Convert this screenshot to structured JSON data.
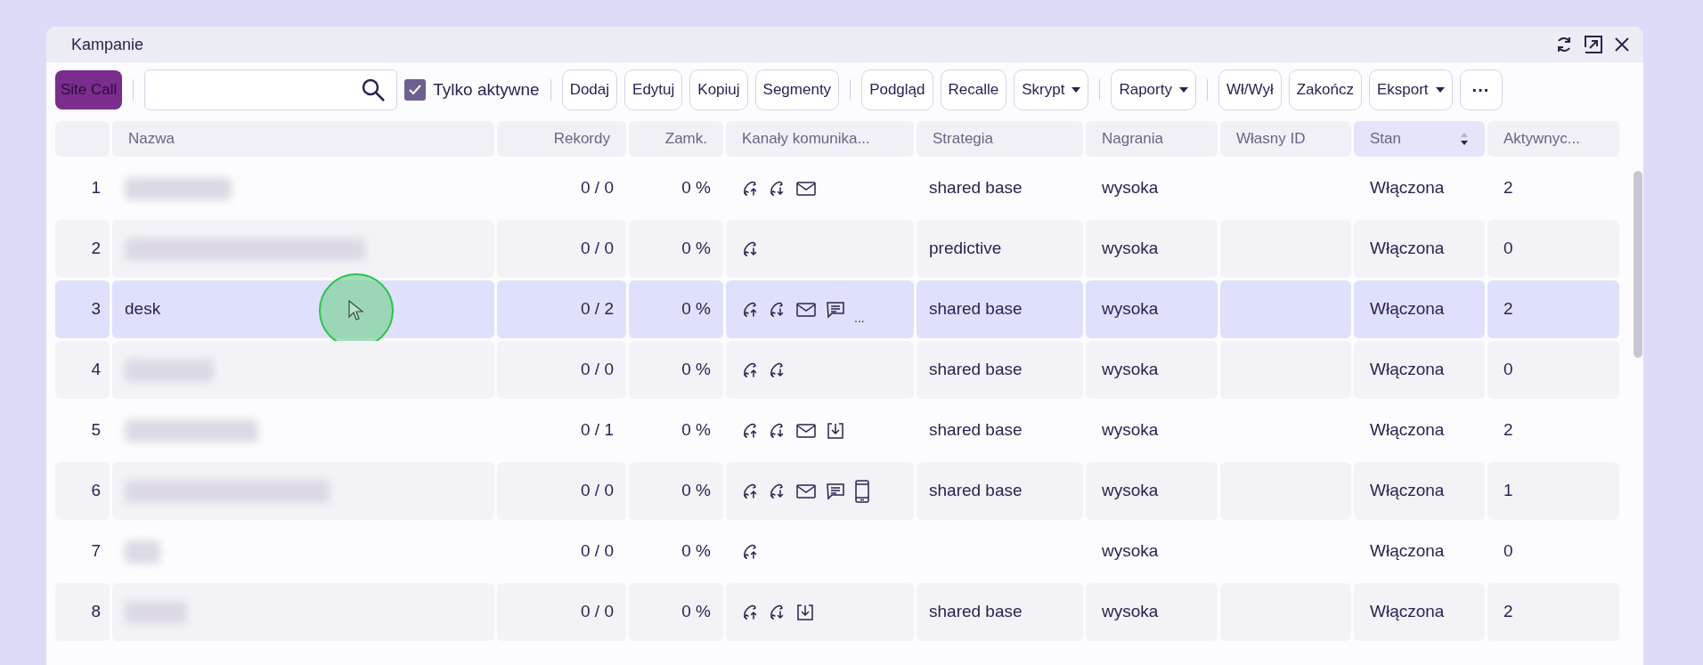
{
  "window": {
    "title": "Kampanie"
  },
  "toolbar": {
    "site_call": "Site Call",
    "only_active": {
      "label": "Tylko aktywne",
      "checked": true
    },
    "groups": [
      [
        {
          "label": "Dodaj",
          "dropdown": false
        },
        {
          "label": "Edytuj",
          "dropdown": false
        },
        {
          "label": "Kopiuj",
          "dropdown": false
        },
        {
          "label": "Segmenty",
          "dropdown": false
        }
      ],
      [
        {
          "label": "Podgląd",
          "dropdown": false
        },
        {
          "label": "Recalle",
          "dropdown": false
        },
        {
          "label": "Skrypt",
          "dropdown": true
        }
      ],
      [
        {
          "label": "Raporty",
          "dropdown": true
        }
      ],
      [
        {
          "label": "Wł/Wył",
          "dropdown": false
        },
        {
          "label": "Zakończ",
          "dropdown": false
        },
        {
          "label": "Eksport",
          "dropdown": true
        }
      ]
    ],
    "more": "···"
  },
  "table": {
    "columns": [
      {
        "label": "Nazwa",
        "sorted": false
      },
      {
        "label": "Rekordy",
        "sorted": false
      },
      {
        "label": "Zamk.",
        "sorted": false
      },
      {
        "label": "Kanały komunika...",
        "sorted": false
      },
      {
        "label": "Strategia",
        "sorted": false
      },
      {
        "label": "Nagrania",
        "sorted": false
      },
      {
        "label": "Własny ID",
        "sorted": false
      },
      {
        "label": "Stan",
        "sorted": true
      },
      {
        "label": "Aktywnyc...",
        "sorted": false
      }
    ],
    "rows": [
      {
        "number": "1",
        "name": {
          "kind": "blurred"
        },
        "records": "0 / 0",
        "closed": "0 %",
        "channels": [
          {
            "kind": "call-out"
          },
          {
            "kind": "call-in"
          },
          {
            "kind": "mail"
          }
        ],
        "strategy": "shared base",
        "recordings": "wysoka",
        "state": "Włączona",
        "active": "2",
        "selected": false
      },
      {
        "number": "2",
        "name": {
          "kind": "blurred"
        },
        "records": "0 / 0",
        "closed": "0 %",
        "channels": [
          {
            "kind": "call-in"
          }
        ],
        "strategy": "predictive",
        "recordings": "wysoka",
        "state": "Włączona",
        "active": "0",
        "selected": false
      },
      {
        "number": "3",
        "name": {
          "kind": "text",
          "text": "desk"
        },
        "records": "0 / 2",
        "closed": "0 %",
        "channels": [
          {
            "kind": "call-out"
          },
          {
            "kind": "call-in"
          },
          {
            "kind": "mail"
          },
          {
            "kind": "chat"
          }
        ],
        "channels_more": "...",
        "strategy": "shared base",
        "recordings": "wysoka",
        "state": "Włączona",
        "active": "2",
        "selected": true
      },
      {
        "number": "4",
        "name": {
          "kind": "blurred"
        },
        "records": "0 / 0",
        "closed": "0 %",
        "channels": [
          {
            "kind": "call-out"
          },
          {
            "kind": "call-in"
          }
        ],
        "strategy": "shared base",
        "recordings": "wysoka",
        "state": "Włączona",
        "active": "0",
        "selected": false
      },
      {
        "number": "5",
        "name": {
          "kind": "blurred"
        },
        "records": "0 / 1",
        "closed": "0 %",
        "channels": [
          {
            "kind": "call-out"
          },
          {
            "kind": "call-in"
          },
          {
            "kind": "mail"
          },
          {
            "kind": "download"
          }
        ],
        "strategy": "shared base",
        "recordings": "wysoka",
        "state": "Włączona",
        "active": "2",
        "selected": false
      },
      {
        "number": "6",
        "name": {
          "kind": "blurred"
        },
        "records": "0 / 0",
        "closed": "0 %",
        "channels": [
          {
            "kind": "call-out"
          },
          {
            "kind": "call-in"
          },
          {
            "kind": "mail"
          },
          {
            "kind": "chat"
          },
          {
            "kind": "mobile"
          }
        ],
        "strategy": "shared base",
        "recordings": "wysoka",
        "state": "Włączona",
        "active": "1",
        "selected": false
      },
      {
        "number": "7",
        "name": {
          "kind": "blurred"
        },
        "records": "0 / 0",
        "closed": "0 %",
        "channels": [
          {
            "kind": "call-out"
          }
        ],
        "recordings": "wysoka",
        "state": "Włączona",
        "active": "0",
        "selected": false
      },
      {
        "number": "8",
        "name": {
          "kind": "blurred"
        },
        "records": "0 / 0",
        "closed": "0 %",
        "channels": [
          {
            "kind": "call-out"
          },
          {
            "kind": "call-in"
          },
          {
            "kind": "download"
          }
        ],
        "strategy": "shared base",
        "recordings": "wysoka",
        "state": "Włączona",
        "active": "2",
        "selected": false
      }
    ]
  }
}
